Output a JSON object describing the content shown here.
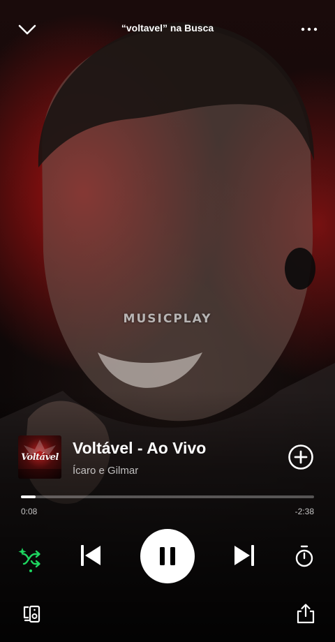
{
  "header": {
    "context_title": "“voltavel” na Busca",
    "collapse_icon": "chevron-down-icon",
    "more_icon": "more-horizontal-icon"
  },
  "canvas": {
    "watermark": "MUSICPLAY"
  },
  "track": {
    "title": "Voltável - Ao Vivo",
    "artist": "Ícaro e Gilmar",
    "cover_text": "Voltável",
    "cover_icon": "album-cover-art",
    "add_icon": "add-circle-icon"
  },
  "playback": {
    "elapsed": "0:08",
    "remaining": "-2:38",
    "progress_fraction": 0.05
  },
  "controls": {
    "shuffle_icon": "smart-shuffle-icon",
    "previous_icon": "skip-previous-icon",
    "play_pause_icon": "pause-icon",
    "next_icon": "skip-next-icon",
    "timer_icon": "sleep-timer-icon"
  },
  "footer": {
    "devices_icon": "connect-device-icon",
    "share_icon": "share-icon"
  },
  "colors": {
    "accent_green": "#1ED760",
    "text_primary": "#FFFFFF",
    "background": "#000000"
  }
}
